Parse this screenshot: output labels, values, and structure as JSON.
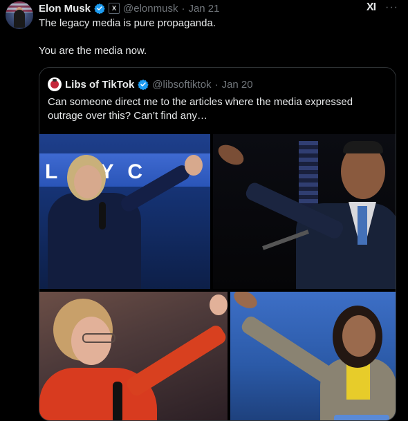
{
  "tweet": {
    "author_name": "Elon Musk",
    "handle": "@elonmusk",
    "separator": "·",
    "date": "Jan 21",
    "affiliate_badge": "X",
    "line1": "The legacy media is pure propaganda.",
    "line2": "You are the media now.",
    "grok_label": "XI",
    "more_label": "···"
  },
  "quote": {
    "author_name": "Libs of TikTok",
    "handle": "@libsoftiktok",
    "separator": "·",
    "date": "Jan 20",
    "text": "Can someone direct me to the articles where the media expressed outrage over this? Can’t find any…"
  },
  "photos": {
    "banner_text": "L  R Y C"
  },
  "colors": {
    "verified": "#1d9bf0",
    "secondary_text": "#71767b",
    "border": "#2f3336"
  },
  "icons": {
    "verified": "verified-badge-icon",
    "grok": "grok-icon",
    "more": "more-options-icon"
  }
}
